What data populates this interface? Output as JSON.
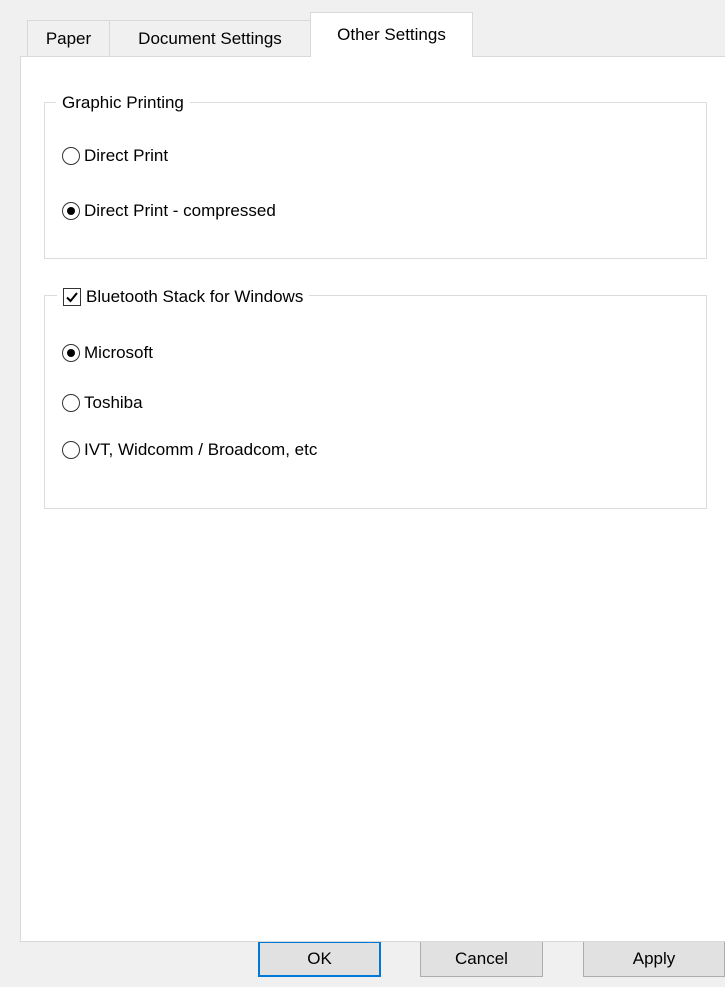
{
  "tabs": {
    "paper": "Paper",
    "document_settings": "Document Settings",
    "other_settings": "Other Settings",
    "active": "Other Settings"
  },
  "graphic_printing": {
    "legend": "Graphic Printing",
    "options": [
      {
        "label": "Direct Print",
        "checked": false
      },
      {
        "label": "Direct Print - compressed",
        "checked": true
      }
    ]
  },
  "bluetooth": {
    "legend": "Bluetooth Stack for Windows",
    "enabled": true,
    "options": [
      {
        "label": "Microsoft",
        "checked": true
      },
      {
        "label": "Toshiba",
        "checked": false
      },
      {
        "label": "IVT, Widcomm / Broadcom, etc",
        "checked": false
      }
    ]
  },
  "buttons": {
    "ok": "OK",
    "cancel": "Cancel",
    "apply": "Apply"
  },
  "colors": {
    "accent": "#0078d7",
    "window_bg": "#f0f0f0",
    "panel_bg": "#ffffff"
  },
  "icons": {
    "checkbox_checked": "checkmark-icon"
  }
}
